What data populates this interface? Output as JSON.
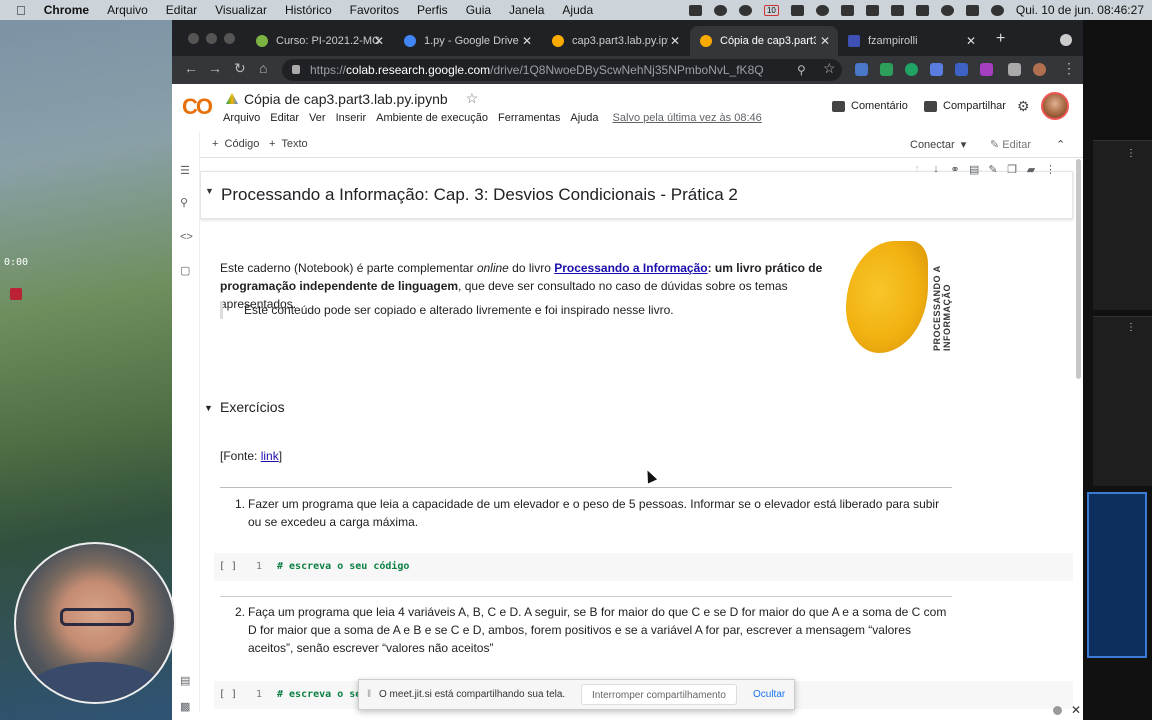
{
  "menubar": {
    "app": "Chrome",
    "items": [
      "Arquivo",
      "Editar",
      "Visualizar",
      "Histórico",
      "Favoritos",
      "Perfis",
      "Guia",
      "Janela",
      "Ajuda"
    ],
    "calendar_day": "10",
    "clock": "Qui. 10 de jun.  08:46:27"
  },
  "desktop": {
    "timer": "0:00"
  },
  "browser": {
    "tabs": [
      {
        "title": "Curso: PI-2021.2-MC",
        "favicon_color": "#7cb342"
      },
      {
        "title": "1.py - Google Drive",
        "favicon_color": "#4285f4"
      },
      {
        "title": "cap3.part3.lab.py.ipyn",
        "favicon_color": "#f9ab00"
      },
      {
        "title": "Cópia de cap3.part3",
        "favicon_color": "#f9ab00"
      },
      {
        "title": "fzampirolli",
        "favicon_color": "#3f51b5"
      }
    ],
    "url_prefix": "https://",
    "url_host": "colab.research.google.com",
    "url_path": "/drive/1Q8NwoeDByScwNehNj35NPmboNvL_fK8Q"
  },
  "colab": {
    "logo": "CO",
    "title": "Cópia de cap3.part3.lab.py.ipynb",
    "menu": [
      "Arquivo",
      "Editar",
      "Ver",
      "Inserir",
      "Ambiente de execução",
      "Ferramentas",
      "Ajuda"
    ],
    "saved": "Salvo pela última vez às 08:46",
    "comment": "Comentário",
    "share": "Compartilhar",
    "add_code": "Código",
    "add_text": "Texto",
    "connect": "Conectar",
    "edit": "Editar"
  },
  "notebook": {
    "section1_title": "Processando a Informação: Cap. 3: Desvios Condicionais - Prática 2",
    "intro_part1": "Este caderno (Notebook) é parte complementar ",
    "intro_online": "online",
    "intro_part2": " do livro ",
    "intro_link": "Processando a Informação",
    "intro_bold": ": um livro prático de programação independente de linguagem",
    "intro_part3": ", que deve ser consultado no caso de dúvidas sobre os temas apresentados.",
    "quote": "Este conteúdo pode ser copiado e alterado livremente e foi inspirado nesse livro.",
    "book_title": "PROCESSANDO A INFORMAÇÃO",
    "section2_title": "Exercícios",
    "source_prefix": "[Fonte: ",
    "source_link": "link",
    "source_suffix": "]",
    "exercises": [
      {
        "num": "1.",
        "text": "Fazer um programa que leia a capacidade de um elevador e o peso de 5 pessoas. Informar se o elevador está liberado para subir ou se excedeu a carga máxima."
      },
      {
        "num": "2.",
        "text": "Faça um programa que leia 4 variáveis A, B, C e D. A seguir, se B for maior do que C e se D for maior do que A e a soma de C com D for maior que a soma de A e B e se C e D, ambos, forem positivos e se a variável A for par, escrever a mensagem “valores aceitos”, senão escrever “valores não aceitos”"
      }
    ],
    "code_cells": [
      {
        "bracket": "[ ]",
        "line": "1",
        "code": "# escreva o seu código"
      },
      {
        "bracket": "[ ]",
        "line": "1",
        "code": "# escreva o seu código"
      }
    ]
  },
  "sharebar": {
    "message": "O meet.jit.si está compartilhando sua tela.",
    "stop": "Interromper compartilhamento",
    "hide": "Ocultar"
  }
}
